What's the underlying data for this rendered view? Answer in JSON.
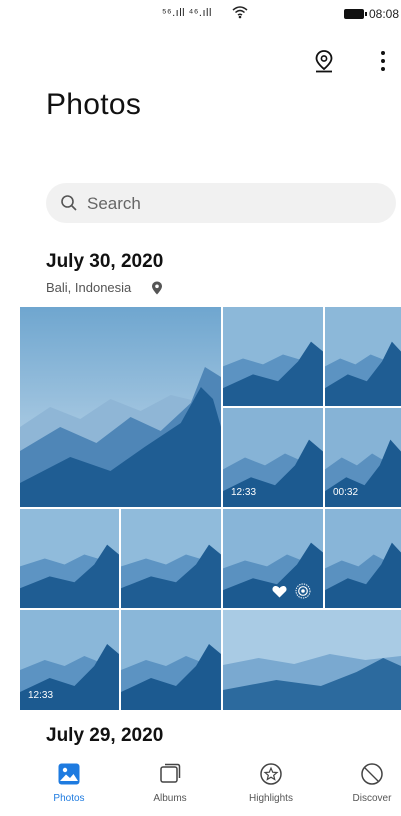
{
  "status_bar": {
    "signal": "⁵⁶.ıll ⁴⁶.ıll",
    "time": "08:08"
  },
  "header": {
    "title": "Photos",
    "location_icon": "location-pin-icon",
    "more_icon": "more-vertical-icon"
  },
  "search": {
    "placeholder": "Search"
  },
  "sections": [
    {
      "date": "July 30, 2020",
      "location": "Bali, Indonesia",
      "photos": [
        {
          "type": "image"
        },
        {
          "type": "image"
        },
        {
          "type": "image"
        },
        {
          "type": "video",
          "duration": "12:33"
        },
        {
          "type": "video",
          "duration": "00:32"
        },
        {
          "type": "image"
        },
        {
          "type": "image"
        },
        {
          "type": "image",
          "favorite": true,
          "live": true
        },
        {
          "type": "image"
        },
        {
          "type": "video",
          "duration": "12:33"
        },
        {
          "type": "image"
        },
        {
          "type": "image"
        }
      ]
    },
    {
      "date": "July 29, 2020"
    }
  ],
  "tabs": [
    {
      "label": "Photos",
      "icon": "photos-icon",
      "active": true
    },
    {
      "label": "Albums",
      "icon": "albums-icon",
      "active": false
    },
    {
      "label": "Highlights",
      "icon": "highlights-icon",
      "active": false
    },
    {
      "label": "Discover",
      "icon": "discover-icon",
      "active": false
    }
  ],
  "colors": {
    "accent": "#1e7be0",
    "search_bg": "#f1f1f1"
  }
}
